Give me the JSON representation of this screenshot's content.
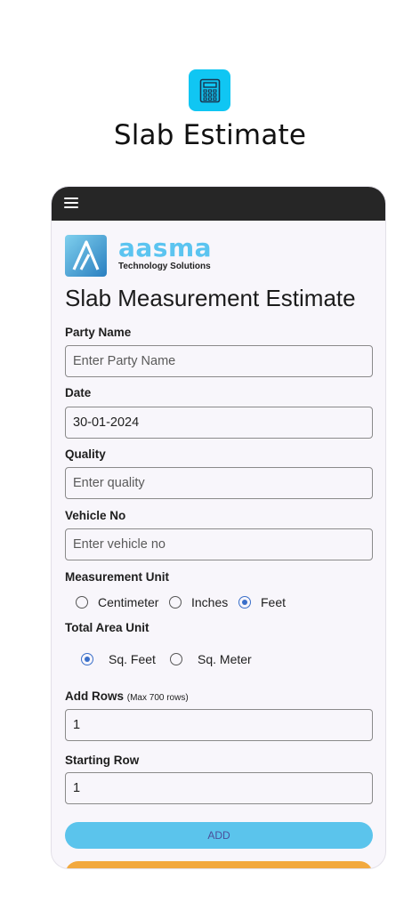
{
  "page": {
    "heading": "Slab Estimate"
  },
  "brand": {
    "name": "aasma",
    "tagline": "Technology Solutions"
  },
  "form": {
    "title": "Slab Measurement Estimate",
    "party_name": {
      "label": "Party Name",
      "placeholder": "Enter Party Name",
      "value": ""
    },
    "date": {
      "label": "Date",
      "value": "30-01-2024"
    },
    "quality": {
      "label": "Quality",
      "placeholder": "Enter quality",
      "value": ""
    },
    "vehicle_no": {
      "label": "Vehicle No",
      "placeholder": "Enter vehicle no",
      "value": ""
    },
    "measurement_unit": {
      "label": "Measurement Unit",
      "options": [
        "Centimeter",
        "Inches",
        "Feet"
      ],
      "selected": "Feet"
    },
    "total_area_unit": {
      "label": "Total Area Unit",
      "options": [
        "Sq. Feet",
        "Sq. Meter"
      ],
      "selected": "Sq. Feet"
    },
    "add_rows": {
      "label": "Add Rows",
      "hint": "(Max 700 rows)",
      "value": "1"
    },
    "starting_row": {
      "label": "Starting Row",
      "value": "1"
    },
    "add_button": "ADD"
  },
  "colors": {
    "app_icon_bg": "#10c6f3",
    "topbar": "#262626",
    "brand": "#5bc4f0",
    "radio_selected": "#3a6fc9",
    "add_button": "#5bc4ec",
    "second_button": "#f2a93e"
  },
  "icons": {
    "app_icon": "calculator-icon",
    "menu": "hamburger-menu-icon",
    "logo": "aasma-logo-icon"
  }
}
